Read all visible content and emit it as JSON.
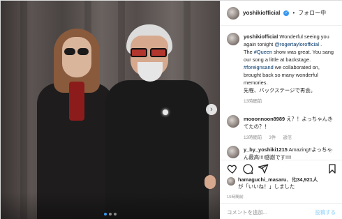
{
  "post": {
    "author": "yoshikiofficial",
    "separator": "•",
    "follow_state": "フォロー中"
  },
  "caption": {
    "user": "yoshikiofficial",
    "t1": "Wonderful seeing you again tonight ",
    "mention": "@rogertaylorofficial",
    "t2": " .",
    "t3": "The ",
    "tag1": "#Queen",
    "t4": " show was great. You sang our song a little at backstage. ",
    "tag2": "#foreignsand",
    "t5": " we collaborated on, brought back so many wonderful memories.",
    "t6": "先程、バックステージで再会。",
    "time": "13時間前"
  },
  "comments": [
    {
      "user": "mooonnoon8989",
      "text": "え？！よっちゃんきてたの？！",
      "time": "13時間前",
      "likes": "3件",
      "reply": "返信"
    },
    {
      "user": "y_by_yoshiki1215",
      "text": "Amazing!!よっちゃん最高!!!!感謝です!!!!"
    }
  ],
  "likes": {
    "user": "hamaguchi_masaru",
    "t1": "、他",
    "count": "34,921人",
    "t2": "が「いいね！」しました"
  },
  "date": "15時間前",
  "add_comment": {
    "placeholder": "コメントを追加...",
    "post_label": "投稿する"
  },
  "icons": {
    "like": "heart-icon",
    "comment": "comment-icon",
    "share": "share-icon",
    "save": "bookmark-icon",
    "next": "chevron-right-icon"
  },
  "carousel": {
    "count": 3,
    "active": 1
  },
  "colors": {
    "link": "#003569",
    "accent": "#3897f0",
    "muted": "#8e8e8e"
  }
}
